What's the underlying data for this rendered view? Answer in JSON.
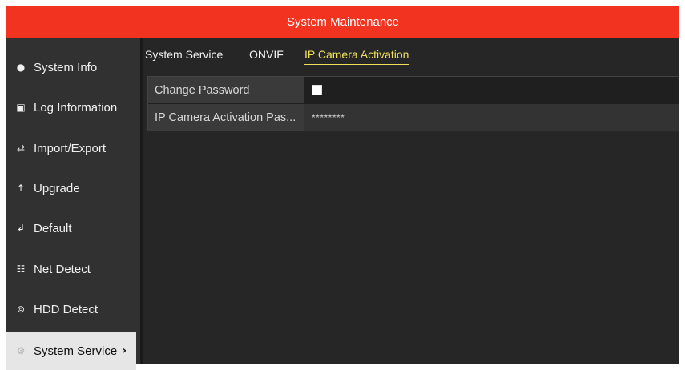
{
  "title": "System Maintenance",
  "sidebar": {
    "items": [
      {
        "label": "System Info",
        "icon": "info-icon"
      },
      {
        "label": "Log Information",
        "icon": "log-icon"
      },
      {
        "label": "Import/Export",
        "icon": "import-export-icon"
      },
      {
        "label": "Upgrade",
        "icon": "upgrade-icon"
      },
      {
        "label": "Default",
        "icon": "default-icon"
      },
      {
        "label": "Net Detect",
        "icon": "network-icon"
      },
      {
        "label": "HDD Detect",
        "icon": "hdd-icon"
      },
      {
        "label": "System Service",
        "icon": "gear-icon",
        "active": true
      }
    ]
  },
  "tabs": [
    {
      "label": "System Service"
    },
    {
      "label": "ONVIF"
    },
    {
      "label": "IP Camera Activation",
      "active": true
    }
  ],
  "form": {
    "change_password_label": "Change Password",
    "change_password_checked": false,
    "activation_password_label": "IP Camera Activation Pas...",
    "activation_password_value": "********"
  },
  "colors": {
    "titlebar": "#f2331f",
    "active_tab": "#f1e15a",
    "sidebar_active_bg": "#e6e6e6"
  }
}
